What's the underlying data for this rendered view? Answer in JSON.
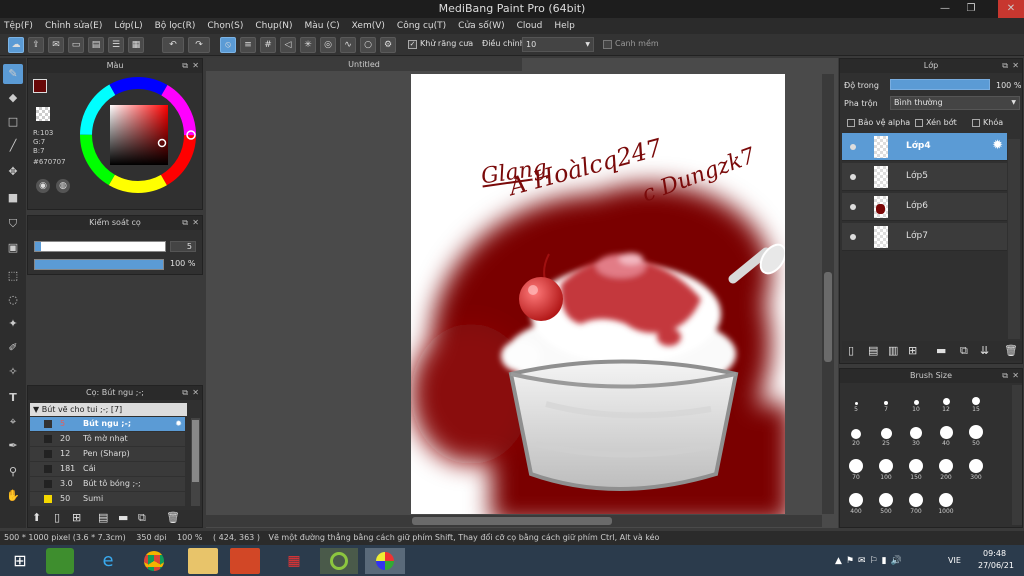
{
  "window": {
    "title": "MediBang Paint Pro (64bit)"
  },
  "menu": [
    "Tệp(F)",
    "Chỉnh sửa(E)",
    "Lớp(L)",
    "Bộ lọc(R)",
    "Chọn(S)",
    "Chụp(N)",
    "Màu (C)",
    "Xem(V)",
    "Công cụ(T)",
    "Cửa số(W)",
    "Cloud",
    "Help"
  ],
  "toolbar": {
    "antialias_label": "Khử răng cưa",
    "correction_label": "Điều chỉnh",
    "correction_value": "10",
    "edge_label": "Canh mềm"
  },
  "color_panel": {
    "title": "Màu",
    "r": "R:103",
    "g": "G:7",
    "b": "B:7",
    "hex": "#670707",
    "current_color": "#670707"
  },
  "brush_control": {
    "title": "Kiểm soát cọ",
    "size": "5",
    "opacity": "100 %",
    "opacity_fraction": 1.0
  },
  "brush_panel": {
    "title": "Cọ: Bút ngu ;-;",
    "group": "Bút vẽ cho tui ;-; [7]",
    "items": [
      {
        "size": "5",
        "name": "Bút ngu ;-;",
        "selected": true
      },
      {
        "size": "20",
        "name": "Tô mờ nhạt"
      },
      {
        "size": "12",
        "name": "Pen (Sharp)"
      },
      {
        "size": "181",
        "name": "Cái"
      },
      {
        "size": "3.0",
        "name": "Bút tô bóng ;-;"
      },
      {
        "size": "50",
        "name": "Sumi"
      }
    ]
  },
  "document": {
    "tab": "Untitled",
    "handwriting_1": "Glang",
    "handwriting_2": "A Hoàlcq247",
    "handwriting_3": "c Dungzk7"
  },
  "layer_panel": {
    "title": "Lớp",
    "opacity_label": "Độ trong",
    "opacity_value": "100 %",
    "blend_label": "Pha trộn",
    "blend_value": "Bình thường",
    "protect_alpha": "Bảo vệ alpha",
    "clipping": "Xén bớt",
    "lock": "Khóa",
    "layers": [
      "Lớp4",
      "Lớp5",
      "Lớp6",
      "Lớp7"
    ]
  },
  "brush_size_panel": {
    "title": "Brush Size",
    "sizes": [
      "5",
      "7",
      "10",
      "12",
      "15",
      "20",
      "25",
      "30",
      "40",
      "50",
      "70",
      "100",
      "150",
      "200",
      "300",
      "400",
      "500",
      "700",
      "1000"
    ]
  },
  "status": {
    "size": "500 * 1000 pixel",
    "cm": "(3.6 * 7.3cm)",
    "dpi": "350 dpi",
    "zoom": "100 %",
    "coords": "( 424, 363 )",
    "hint": "Vẽ một đường thẳng bằng cách giữ phím Shift, Thay đổi cỡ cọ bằng cách giữ phím Ctrl, Alt và kéo"
  },
  "taskbar": {
    "lang": "VIE",
    "time": "09:48",
    "date": "27/06/21"
  }
}
